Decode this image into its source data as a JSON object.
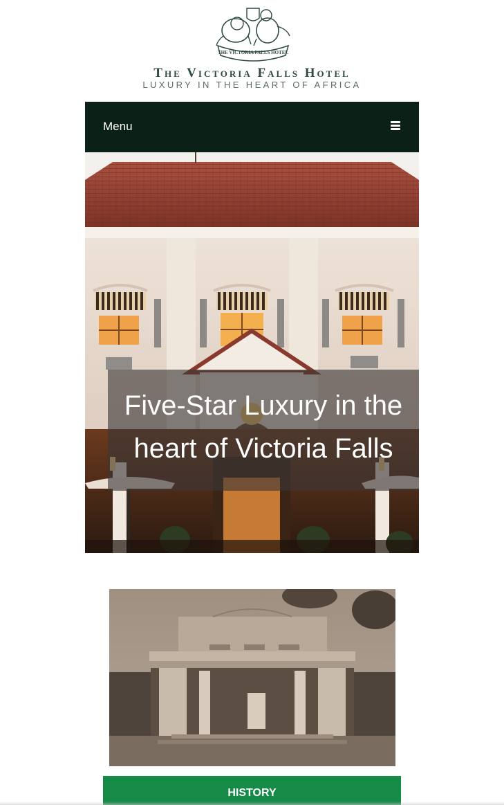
{
  "header": {
    "logo_title": "The Victoria Falls Hotel",
    "logo_tagline": "LUXURY IN THE HEART OF AFRICA",
    "emblem_text": "THE VICTORIA FALLS HOTEL"
  },
  "nav": {
    "menu_label": "Menu",
    "menu_icon": "hamburger-icon"
  },
  "hero": {
    "caption_line1": "Five-Star Luxury in the",
    "caption_line2": "heart of Victoria Falls"
  },
  "history": {
    "button_label": "HISTORY"
  },
  "colors": {
    "nav_background": "#0b2118",
    "history_button": "#168a47",
    "logo_text": "#2f4a3e"
  }
}
